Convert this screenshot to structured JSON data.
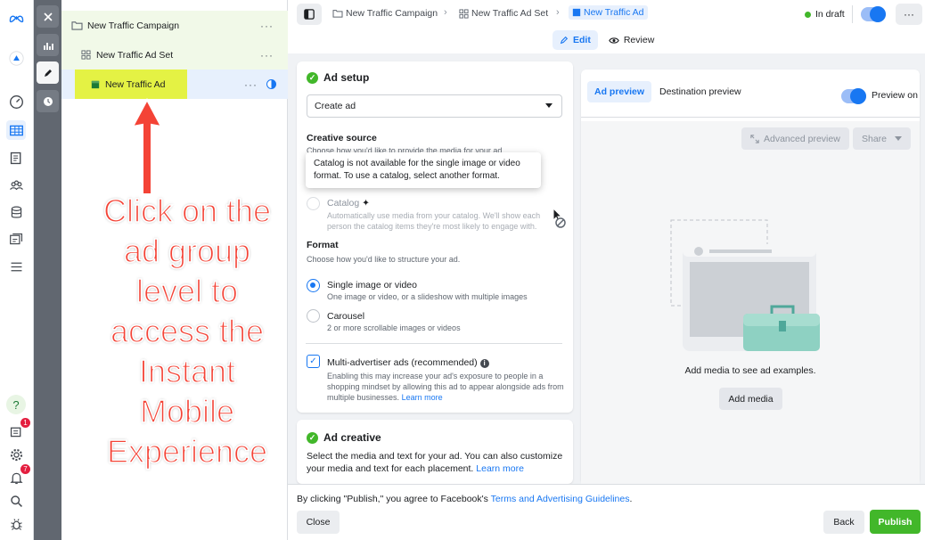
{
  "rail": {
    "badges": {
      "notifications": "1",
      "alerts": "7"
    },
    "help": "?"
  },
  "tree": {
    "campaign": "New Traffic Campaign",
    "adset": "New Traffic Ad Set",
    "ad": "New Traffic Ad",
    "more": "···"
  },
  "annotation": "Click on the ad group level to access the Instant Mobile Experience",
  "header": {
    "breadcrumbs": [
      "New Traffic Campaign",
      "New Traffic Ad Set",
      "New Traffic Ad"
    ],
    "status": "In draft",
    "more": "···",
    "edit": "Edit",
    "review": "Review"
  },
  "ad_setup": {
    "title": "Ad setup",
    "create_select": "Create ad",
    "creative_source_label": "Creative source",
    "creative_source_sub": "Choose how you'd like to provide the media for your ad.",
    "tooltip": "Catalog is not available for the single image or video format. To use a catalog, select another format.",
    "catalog_label": "Catalog",
    "catalog_sub": "Automatically use media from your catalog. We'll show each person the catalog items they're most likely to engage with.",
    "format_label": "Format",
    "format_sub": "Choose how you'd like to structure your ad.",
    "single_label": "Single image or video",
    "single_sub": "One image or video, or a slideshow with multiple images",
    "carousel_label": "Carousel",
    "carousel_sub": "2 or more scrollable images or videos",
    "multi_label": "Multi-advertiser ads (recommended)",
    "multi_sub": "Enabling this may increase your ad's exposure to people in a shopping mindset by allowing this ad to appear alongside ads from multiple businesses.",
    "learn_more": "Learn more"
  },
  "ad_creative": {
    "title": "Ad creative",
    "sub": "Select the media and text for your ad. You can also customize your media and text for each placement.",
    "learn_more": "Learn more"
  },
  "preview": {
    "tab_ad": "Ad preview",
    "tab_dest": "Destination preview",
    "toggle_label": "Preview on",
    "advanced": "Advanced preview",
    "share": "Share",
    "empty": "Add media to see ad examples.",
    "add_media": "Add media"
  },
  "footer": {
    "text_before": "By clicking \"Publish,\" you agree to Facebook's",
    "terms": "Terms and Advertising Guidelines",
    "text_after": ".",
    "close": "Close",
    "back": "Back",
    "publish": "Publish"
  },
  "colors": {
    "accent": "#1877f2",
    "success": "#42b72a",
    "publish": "#42b72a",
    "annotation": "#f44336",
    "highlight": "#e4f244"
  }
}
